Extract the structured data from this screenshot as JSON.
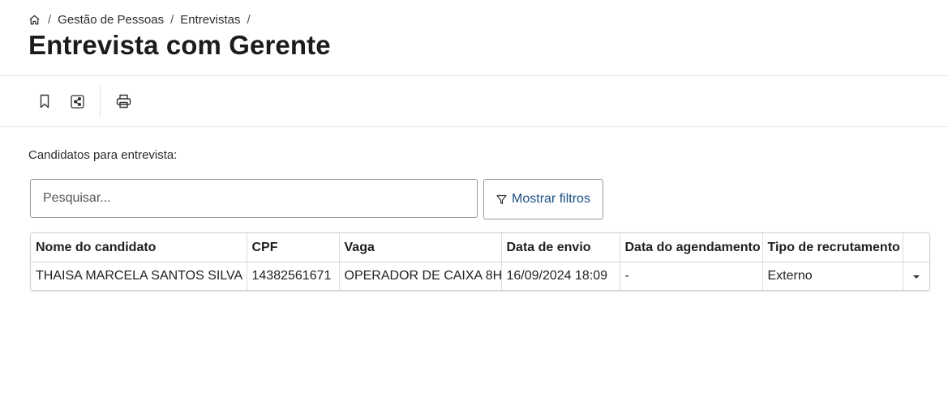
{
  "breadcrumb": {
    "home_icon": "home-icon",
    "items": [
      "Gestão de Pessoas",
      "Entrevistas"
    ],
    "separator": "/"
  },
  "page": {
    "title": "Entrevista com Gerente"
  },
  "toolbar": {
    "icons": [
      "bookmark-icon",
      "share-icon",
      "print-icon"
    ]
  },
  "content": {
    "section_label": "Candidatos para entrevista:",
    "search": {
      "placeholder": "Pesquisar...",
      "value": ""
    },
    "filter_button": {
      "label": "Mostrar filtros",
      "icon": "filter-icon",
      "color": "#1b4f86"
    }
  },
  "table": {
    "columns": [
      "Nome do candidato",
      "CPF",
      "Vaga",
      "Data de envio",
      "Data do agendamento",
      "Tipo de recrutamento"
    ],
    "rows": [
      {
        "nome": "THAISA MARCELA SANTOS SILVA",
        "cpf": "14382561671",
        "vaga": "OPERADOR DE CAIXA 8H",
        "data_envio": "16/09/2024 18:09",
        "data_agendamento": "-",
        "tipo": "Externo",
        "action_icon": "caret-down-icon"
      }
    ]
  }
}
